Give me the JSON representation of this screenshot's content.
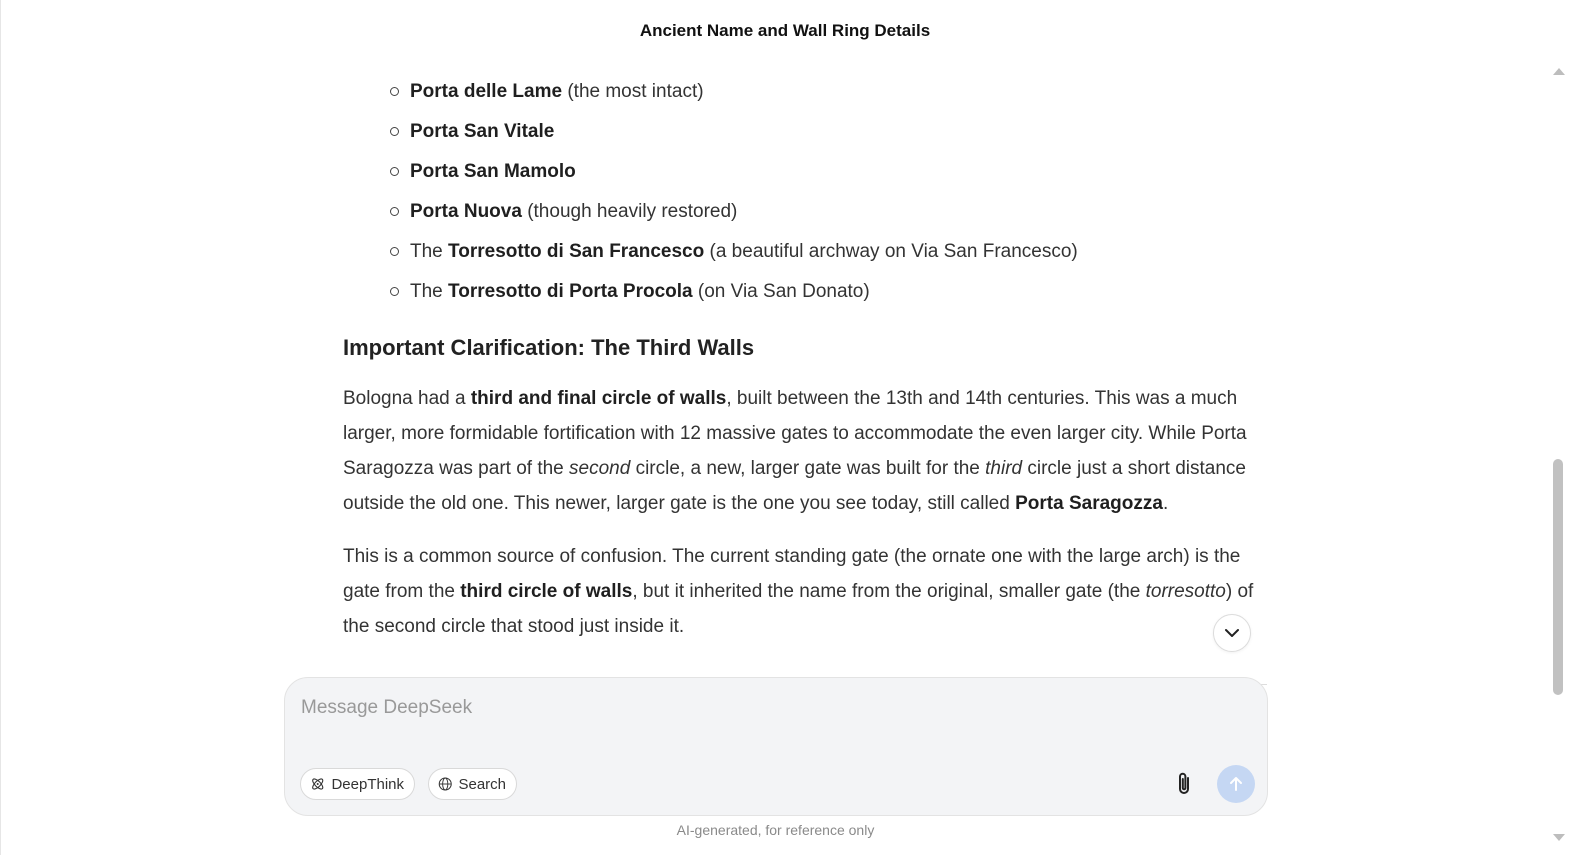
{
  "header": {
    "title": "Ancient Name and Wall Ring Details"
  },
  "gates": [
    {
      "prefix": "",
      "name": "Porta delle Lame",
      "note": " (the most intact)"
    },
    {
      "prefix": "",
      "name": "Porta San Vitale",
      "note": ""
    },
    {
      "prefix": "",
      "name": "Porta San Mamolo",
      "note": ""
    },
    {
      "prefix": "",
      "name": "Porta Nuova",
      "note": " (though heavily restored)"
    },
    {
      "prefix": "The ",
      "name": "Torresotto di San Francesco",
      "note": " (a beautiful archway on Via San Francesco)"
    },
    {
      "prefix": "The ",
      "name": "Torresotto di Porta Procola",
      "note": " (on Via San Donato)"
    }
  ],
  "section": {
    "heading": "Important Clarification: The Third Walls",
    "p1": {
      "t1": "Bologna had a ",
      "b1": "third and final circle of walls",
      "t2": ", built between the 13th and 14th centuries. This was a much larger, more formidable fortification with 12 massive gates to accommodate the even larger city. While Porta Saragozza was part of the ",
      "i1": "second",
      "t3": " circle, a new, larger gate was built for the ",
      "i2": "third",
      "t4": " circle just a short distance outside the old one. This newer, larger gate is the one you see today, still called ",
      "b2": "Porta Saragozza",
      "t5": "."
    },
    "p2": {
      "t1": "This is a common source of confusion. The current standing gate (the ornate one with the large arch) is the gate from the ",
      "b1": "third circle of walls",
      "t2": ", but it inherited the name from the original, smaller gate (the ",
      "i1": "torresotto",
      "t3": ") of the second circle that stood just inside it."
    }
  },
  "composer": {
    "placeholder": "Message DeepSeek",
    "deepthink_label": "DeepThink",
    "search_label": "Search"
  },
  "footer": {
    "disclaimer": "AI-generated, for reference only"
  },
  "icons": {
    "deepthink": "deepthink-atom-icon",
    "search": "globe-icon",
    "attach": "paperclip-icon",
    "send": "arrow-up-icon",
    "scroll_down": "chevron-down-icon"
  },
  "colors": {
    "send_disabled": "#c5d7f3",
    "composer_bg": "#f3f4f6"
  }
}
